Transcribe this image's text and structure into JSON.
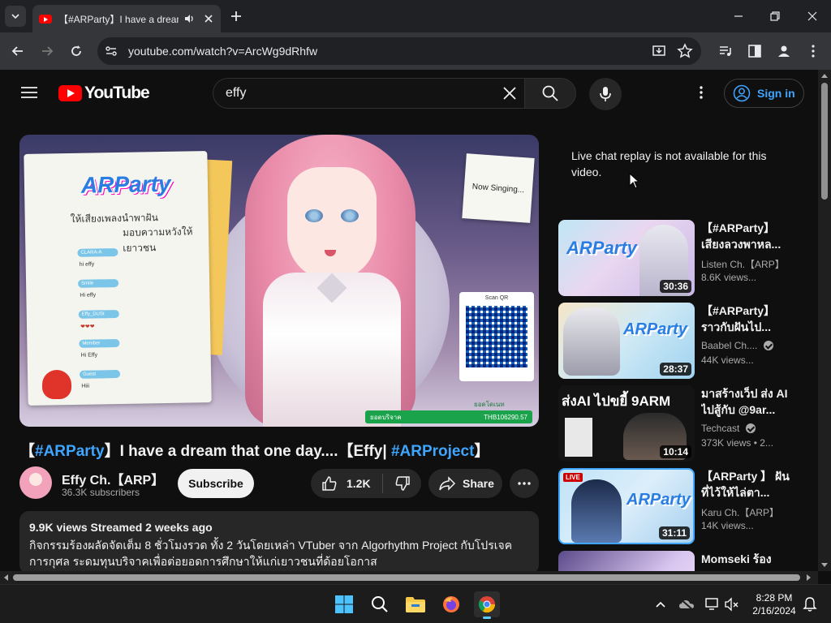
{
  "browser": {
    "tab_title": "【#ARParty】I have a dream t",
    "url": "youtube.com/watch?v=ArcWg9dRhfw"
  },
  "header": {
    "logo_text": "YouTube",
    "search_query": "effy",
    "signin_label": "Sign in"
  },
  "player": {
    "overlay": {
      "now_singing": "Now Singing...",
      "scan_qr": "Scan QR",
      "logo": "ARParty",
      "thai_line1": "ให้เสียงเพลงนำพาฝัน",
      "thai_line2": "มอบความหวังให้เยาวชน",
      "chat": [
        {
          "name": "CLARA-A",
          "msg": "hi effy"
        },
        {
          "name": "Smile",
          "msg": "Hi effy"
        },
        {
          "name": "Effy_DUSt",
          "msg": "❤❤❤"
        },
        {
          "name": "Member",
          "msg": "Hi Effy"
        },
        {
          "name": "Guest",
          "msg": "Hiii"
        }
      ],
      "donate_label": "ยอดบริจาค",
      "donate_amount": "THB106290.57",
      "donate_top": "ยอดโดเนท"
    }
  },
  "video": {
    "title_parts": [
      "【",
      "#ARParty",
      "】I have a dream that one day....【Effy| ",
      "#ARProject",
      "】"
    ],
    "channel": "Effy Ch.【ARP】",
    "subscribers": "36.3K subscribers",
    "subscribe_label": "Subscribe",
    "likes": "1.2K",
    "share_label": "Share",
    "meta": "9.9K views  Streamed 2 weeks ago",
    "description": "กิจกรรมร้องผลัดจัดเต็ม 8 ชั่วโมงรวด ทั้ง 2 วันโดยเหล่า VTuber จาก Algorhythm Project กับโปรเจคการกุศล ระดมทุนบริจาคเพื่อต่อยอดการศึกษาให้แก่เยาวชนที่ด้อยโอกาส"
  },
  "live_chat_message": "Live chat replay is not available for this video.",
  "recommendations": [
    {
      "title": "【#ARParty】 เสียงลวงพาหล...",
      "channel": "Listen Ch.【ARP】",
      "views": "8.6K views...",
      "duration": "30:36",
      "verified": false,
      "live": false
    },
    {
      "title": "【#ARParty】 ราวกับฝันไป...",
      "channel": "Baabel Ch....",
      "views": "44K views...",
      "duration": "28:37",
      "verified": true,
      "live": false
    },
    {
      "title": "มาสร้างเว็ป ส่ง AI ไปสู้กับ @9ar...",
      "channel": "Techcast",
      "views": "373K views  • 2...",
      "duration": "10:14",
      "verified": true,
      "live": false,
      "thumb_text": "ส่งAI ไปขยี้ 9ARM"
    },
    {
      "title": "【ARParty 】 ฝันที่ไว้ให้ไล่ตา...",
      "channel": "Karu Ch.【ARP】",
      "views": "14K views...",
      "duration": "31:11",
      "verified": false,
      "live": true,
      "live_label": "LIVE"
    },
    {
      "title": "Momseki ร้อง",
      "channel": "",
      "views": "",
      "duration": "",
      "verified": false,
      "live": false
    }
  ],
  "taskbar": {
    "time": "8:28 PM",
    "date": "2/16/2024"
  }
}
